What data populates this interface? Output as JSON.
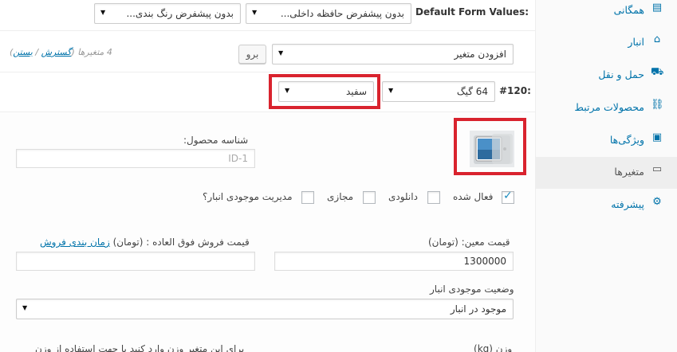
{
  "defaults": {
    "label": "Default Form Values:",
    "select1": "بدون پیشفرض حافظه داخلی...",
    "select2": "بدون پیشفرض رنگ بندی..."
  },
  "toolbar": {
    "add_variation": "افزودن متغیر",
    "go_button": "برو",
    "count_text": "4 متغیرها",
    "expand_link": "گسترش",
    "close_link": "بستن",
    "paren_open": "(",
    "slash": " / ",
    "paren_close": ")"
  },
  "variation": {
    "id": "#120:",
    "memory_value": "64 گیگ",
    "color_value": "سفید",
    "sku_label": "شناسه محصول:",
    "sku_placeholder": "ID-1",
    "enabled_label": "فعال شده",
    "downloadable_label": "دانلودی",
    "virtual_label": "مجازی",
    "manage_stock_label": "مدیریت موجودی انبار؟",
    "regular_price_label": "قیمت معین: (تومان)",
    "regular_price_value": "1300000",
    "sale_price_label": "قیمت فروش فوق العاده : (تومان)",
    "schedule_link": "زمان بندی فروش",
    "stock_status_label": "وضعیت موجودی انبار",
    "stock_status_value": "موجود در انبار",
    "weight_label": "وزن (kg)",
    "weight_hint": "برای این متغیر وزن وارد کنید یا جهت استفاده از وزن"
  },
  "sidebar": {
    "items": [
      {
        "label": "همگانی",
        "icon": "general-icon"
      },
      {
        "label": "انبار",
        "icon": "inventory-icon"
      },
      {
        "label": "حمل و نقل",
        "icon": "shipping-icon"
      },
      {
        "label": "محصولات مرتبط",
        "icon": "linked-products-icon"
      },
      {
        "label": "ویژگی‌ها",
        "icon": "attributes-icon"
      },
      {
        "label": "متغیرها",
        "icon": "variations-icon"
      },
      {
        "label": "پیشرفته",
        "icon": "advanced-icon"
      }
    ],
    "active_index": 5
  },
  "colors": {
    "highlight_box": "#d9232e",
    "link": "#0073aa"
  }
}
